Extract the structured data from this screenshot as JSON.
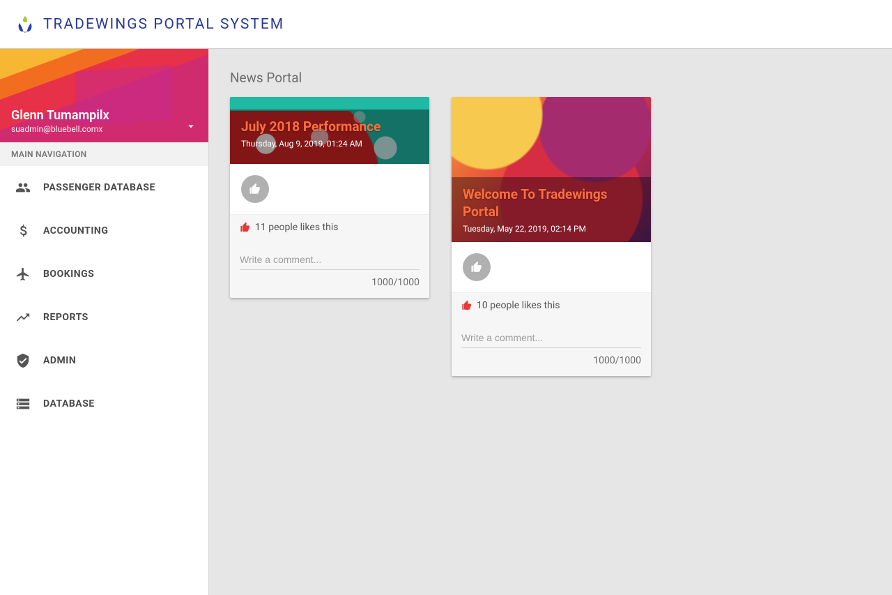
{
  "brand": {
    "title": "TRADEWINGS PORTAL SYSTEM"
  },
  "user": {
    "name": "Glenn Tumampilx",
    "email": "suadmin@bluebell.comx"
  },
  "sidebar": {
    "section_label": "MAIN NAVIGATION",
    "items": [
      {
        "label": "PASSENGER DATABASE",
        "icon": "group-icon"
      },
      {
        "label": "ACCOUNTING",
        "icon": "dollar-icon"
      },
      {
        "label": "BOOKINGS",
        "icon": "airplane-icon"
      },
      {
        "label": "REPORTS",
        "icon": "trending-up-icon"
      },
      {
        "label": "ADMIN",
        "icon": "shield-check-icon"
      },
      {
        "label": "DATABASE",
        "icon": "storage-icon"
      }
    ]
  },
  "main": {
    "title": "News Portal"
  },
  "cards": [
    {
      "title": "July 2018 Performance",
      "date": "Thursday, Aug 9, 2019, 01:24 AM",
      "likes_text": "11 people likes this",
      "comment_placeholder": "Write a comment...",
      "counter": "1000/1000"
    },
    {
      "title": "Welcome To Tradewings Portal",
      "date": "Tuesday, May 22, 2019, 02:14 PM",
      "likes_text": "10 people likes this",
      "comment_placeholder": "Write a comment...",
      "counter": "1000/1000"
    }
  ]
}
